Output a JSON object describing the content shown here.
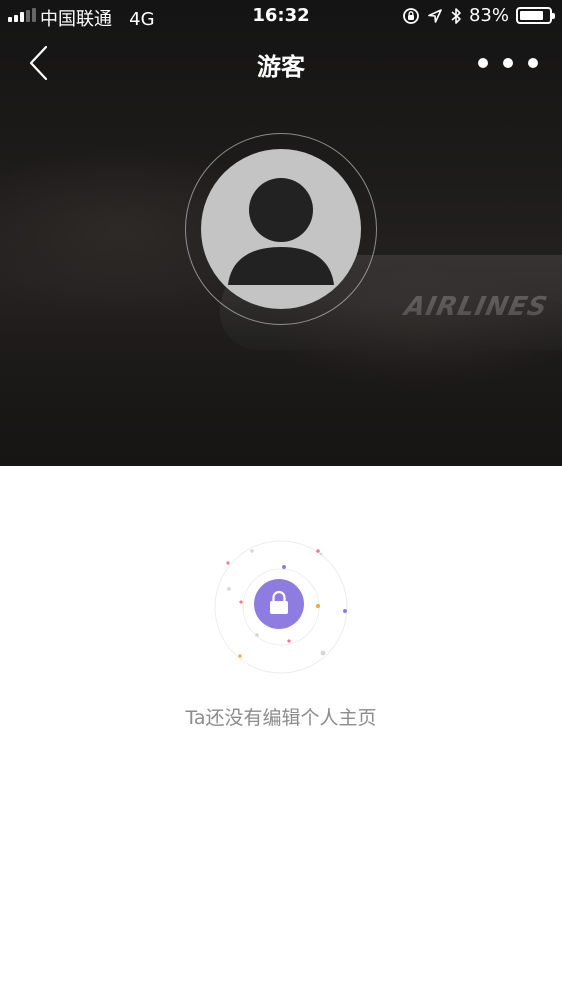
{
  "status_bar": {
    "carrier": "中国联通",
    "network": "4G",
    "time": "16:32",
    "battery_percent_label": "83%",
    "battery_level": 0.83,
    "icons": [
      "rotation-lock-icon",
      "location-arrow-icon",
      "bluetooth-icon"
    ]
  },
  "nav": {
    "title": "游客",
    "back_icon": "chevron-left-icon",
    "more_icon": "more-dots-icon"
  },
  "profile": {
    "avatar_icon": "default-user-avatar-icon",
    "background_text": "AIRLINES"
  },
  "empty_state": {
    "icon": "lock-icon",
    "accent_color": "#8e7ce0",
    "message": "Ta还没有编辑个人主页"
  }
}
